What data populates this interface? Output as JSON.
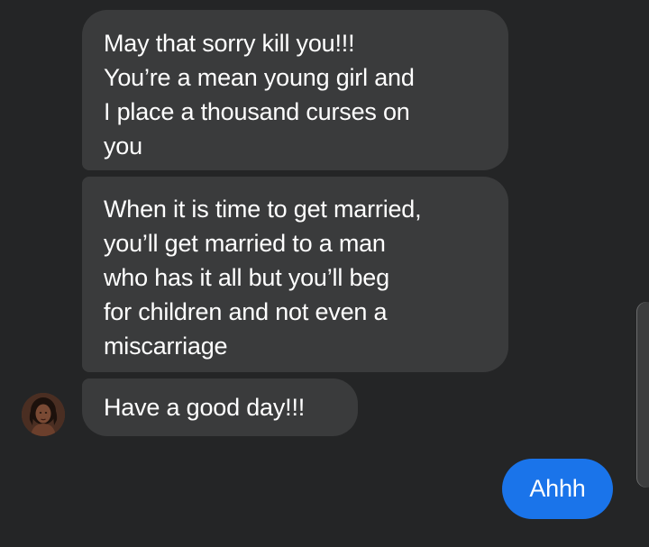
{
  "messages": {
    "received": [
      {
        "lines": [
          "May that sorry kill you!!!",
          "You’re a mean young girl and",
          "I place a thousand curses on",
          "you"
        ]
      },
      {
        "lines": [
          "When it is time to get married,",
          "you’ll get married to a man",
          "who has it all but you’ll beg",
          "for children and not even a",
          "miscarriage"
        ]
      },
      {
        "lines": [
          "Have a good day!!!"
        ]
      }
    ],
    "sent": [
      {
        "text": "Ahhh"
      }
    ]
  },
  "colors": {
    "background": "#242526",
    "received_bubble": "#3a3b3c",
    "sent_bubble": "#1a74ea",
    "text": "#ffffff"
  },
  "icons": {
    "contact_avatar": "avatar"
  }
}
